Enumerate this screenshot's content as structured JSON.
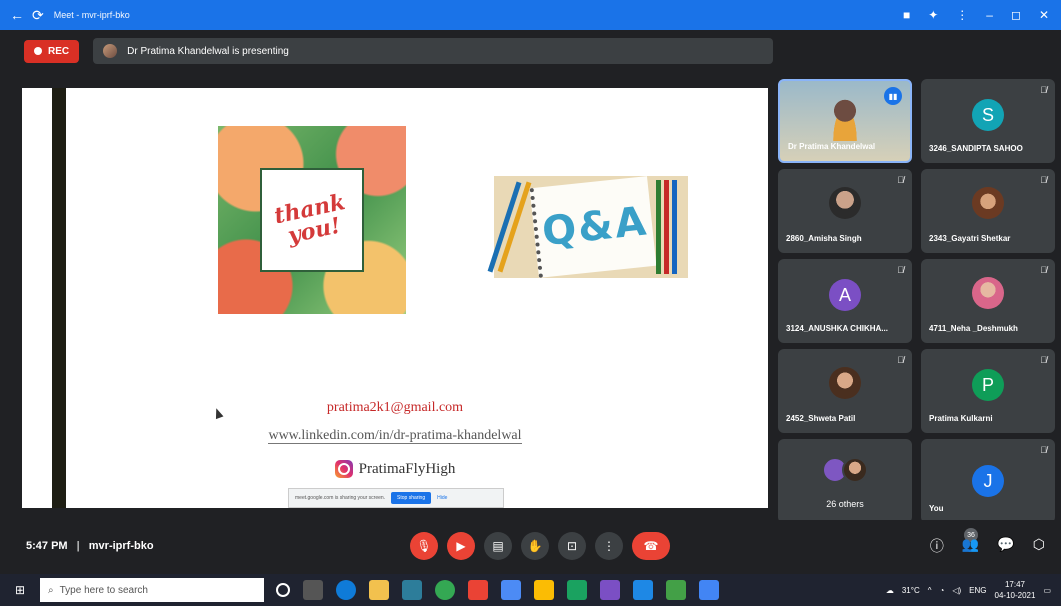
{
  "titlebar": {
    "title": "Meet - mvr-iprf-bko"
  },
  "topbar": {
    "rec_label": "REC",
    "presenting_text": "Dr Pratima Khandelwal is presenting"
  },
  "slide": {
    "thank_you_text": "thank you!",
    "qa_text": "Q&A",
    "email": "pratima2k1@gmail.com",
    "linkedin": "www.linkedin.com/in/dr-pratima-khandelwal",
    "instagram": "PratimaFlyHigh",
    "sharebar": {
      "message": "meet.google.com is sharing your screen.",
      "stop": "Stop sharing",
      "hide": "Hide"
    }
  },
  "tiles": [
    {
      "name": "Dr Pratima Khandelwal"
    },
    {
      "name": "3246_SANDIPTA SAHOO",
      "letter": "S",
      "color": "#12a4b5"
    },
    {
      "name": "2860_Amisha Singh"
    },
    {
      "name": "2343_Gayatri Shetkar"
    },
    {
      "name": "3124_ANUSHKA CHIKHA...",
      "letter": "A",
      "color": "#7b4fc4"
    },
    {
      "name": "4711_Neha _Deshmukh"
    },
    {
      "name": "2452_Shweta Patil"
    },
    {
      "name": "Pratima Kulkarni",
      "letter": "P",
      "color": "#0f9d58"
    },
    {
      "name": "26 others"
    },
    {
      "name": "You",
      "letter": "J",
      "color": "#1a73e8"
    }
  ],
  "bottombar": {
    "time": "5:47 PM",
    "separator": "|",
    "meeting_code": "mvr-iprf-bko",
    "participant_count": "36"
  },
  "taskbar": {
    "search_placeholder": "Type here to search",
    "weather": "31°C",
    "lang": "ENG",
    "time": "17:47",
    "date": "04-10-2021"
  }
}
